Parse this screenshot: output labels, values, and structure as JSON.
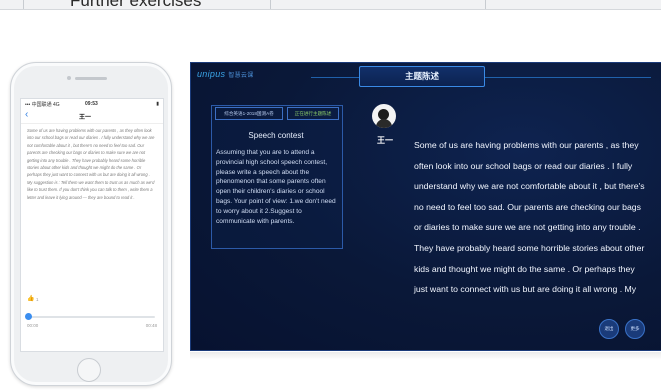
{
  "top": {
    "title": "Further exercises"
  },
  "phone": {
    "status": {
      "carrier": "••• 中国联通 4G",
      "time": "09:53",
      "battery": "▮"
    },
    "nav": {
      "back": "‹",
      "name": "王一"
    },
    "message": "Some of us are having problems with our parents , as they often look into our school bags or read our diaries . I fully understand why we are not comfortable about it , but there's no need to feel too sad. Our parents are checking our bags or diaries to make sure we are not getting into any trouble . They have probably heard some horrible stories about other kids and thought we might do the same . Or perhaps they just want to connect with us but are doing it all wrong . My suggestion is : Tell them we want them to trust us as much as we'd like to trust them. If you don't think you can talk to them , write them a letter and leave it lying around — they are bound to read it .",
    "likes": "1",
    "progress": 0.0,
    "time_start": "00:00",
    "time_end": "00:48"
  },
  "panel": {
    "logo": "unipus",
    "logo_sub": "智慧云课",
    "tab": "主题陈述",
    "chip1": "综合英语1-2018国测A卷",
    "chip2": "正在进行主题陈述",
    "card_title": "Speech contest",
    "card_body": "Assuming that you are to attend a provincial high school speech contest, please write a speech about the phenomenon that some parents often open their children's diaries or school bags. Your point of view: 1.we don't need to worry about it 2.Suggest to communicate with parents.",
    "speaker": "王一",
    "main_text": "Some of us are having problems with our parents , as they often look into our school bags or read our diaries . I fully understand why we are not comfortable about it , but there's no need to feel too sad. Our parents are checking our bags or diaries to make sure we are not getting into any trouble . They have probably heard some horrible stories about other kids and thought we might do the same . Or perhaps they just want to connect with us but are doing it all wrong . My",
    "btn1": "退出",
    "btn2": "更多"
  }
}
